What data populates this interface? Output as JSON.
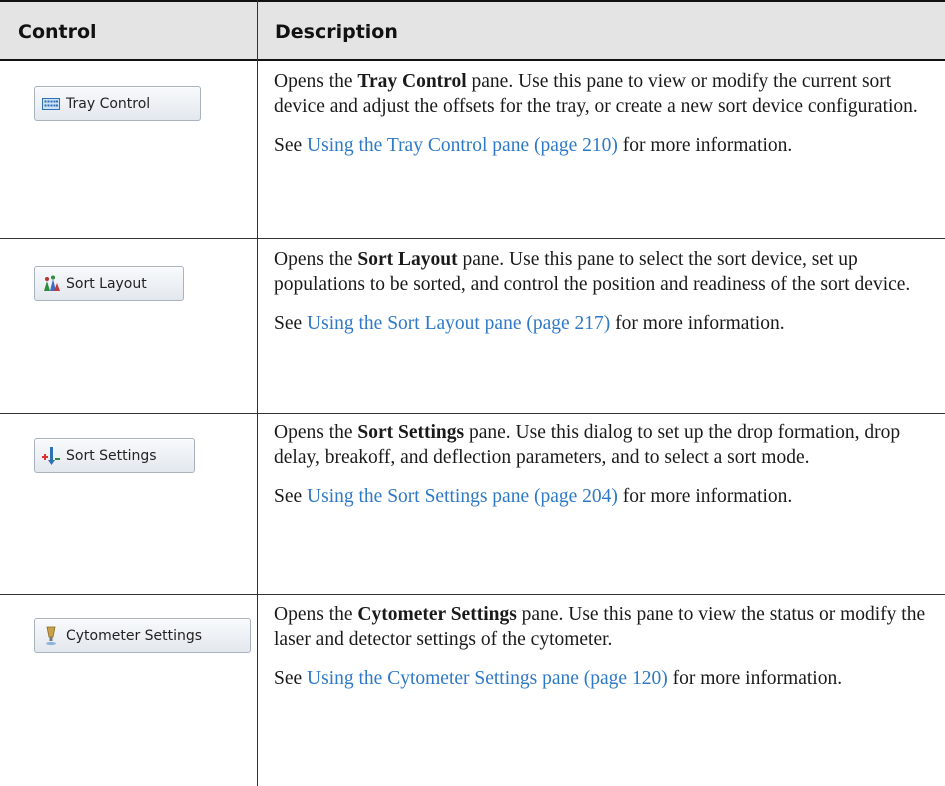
{
  "header": {
    "col_control": "Control",
    "col_description": "Description"
  },
  "rows": [
    {
      "button_label": "Tray Control",
      "icon": "tray-icon",
      "desc_pre": "Opens the ",
      "desc_bold": "Tray Control",
      "desc_post": " pane. Use this pane to view or modify the current sort device and adjust the offsets for the tray, or create a new sort device configuration.",
      "see_pre": "See ",
      "see_link": "Using the Tray Control pane (page 210)",
      "see_post": " for more information."
    },
    {
      "button_label": "Sort Layout",
      "icon": "sort-layout-icon",
      "desc_pre": "Opens the ",
      "desc_bold": "Sort Layout",
      "desc_post": " pane. Use this pane to select the sort device, set up populations to be sorted, and control the position and readiness of the sort device.",
      "see_pre": "See ",
      "see_link": "Using the Sort Layout pane (page 217)",
      "see_post": " for more information."
    },
    {
      "button_label": "Sort Settings",
      "icon": "sort-settings-icon",
      "desc_pre": "Opens the ",
      "desc_bold": "Sort Settings",
      "desc_post": " pane. Use this dialog to set up the drop formation, drop delay, breakoff, and deflection parameters, and to select a sort mode.",
      "see_pre": "See ",
      "see_link": "Using the Sort Settings pane (page 204)",
      "see_post": " for more information."
    },
    {
      "button_label": "Cytometer Settings",
      "icon": "cytometer-icon",
      "desc_pre": "Opens the ",
      "desc_bold": "Cytometer Settings",
      "desc_post": " pane. Use this pane to view the status or modify the laser and detector settings of the cytometer.",
      "see_pre": "See ",
      "see_link": "Using the Cytometer Settings pane (page 120)",
      "see_post": " for more information."
    }
  ]
}
